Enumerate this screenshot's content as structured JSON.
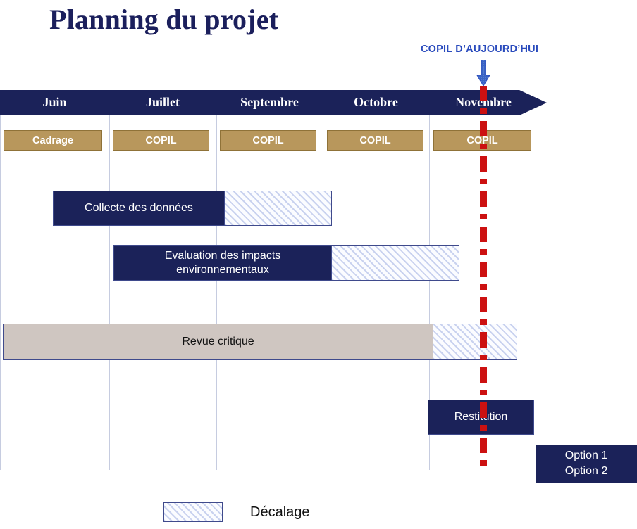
{
  "title": "Planning du projet",
  "today_marker": {
    "label": "COPIL D’AUJOURD’HUI",
    "icon": "down-arrow-icon",
    "color": "#2a4bbd",
    "line_color": "#cc1111",
    "at_month": "Novembre"
  },
  "timeline": {
    "months": [
      "Juin",
      "Juillet",
      "Septembre",
      "Octobre",
      "Novembre"
    ],
    "band_color": "#1b2259",
    "text_color": "#ffffff"
  },
  "milestones": {
    "fill_color": "#b8975c",
    "items": [
      "Cadrage",
      "COPIL",
      "COPIL",
      "COPIL",
      "COPIL"
    ]
  },
  "tasks": [
    {
      "label": "Collecte des données",
      "style": "dark",
      "has_delay": true
    },
    {
      "label": "Evaluation des impacts environnementaux",
      "style": "dark",
      "has_delay": true
    },
    {
      "label": "Revue critique",
      "style": "light",
      "has_delay": true
    },
    {
      "label": "Restitution",
      "style": "dark",
      "has_delay": false
    }
  ],
  "options_box": {
    "line1": "Option 1",
    "line2": "Option 2"
  },
  "legend": {
    "swatch_name": "hatched-delay-swatch",
    "label": "Décalage"
  },
  "chart_data": {
    "type": "gantt",
    "title": "Planning du projet",
    "categories": [
      "Juin",
      "Juillet",
      "Septembre",
      "Octobre",
      "Novembre"
    ],
    "today_line_month": "Novembre",
    "bars": [
      {
        "name": "Collecte des données",
        "start_month": "Juin",
        "end_month": "Septembre",
        "delay_end_month": "Octobre"
      },
      {
        "name": "Evaluation des impacts environnementaux",
        "start_month": "Juillet",
        "end_month": "Octobre",
        "delay_end_month": "Novembre"
      },
      {
        "name": "Revue critique",
        "start_month": "Juin",
        "end_month": "Novembre",
        "delay_end_month": "Novembre"
      },
      {
        "name": "Restitution",
        "start_month": "Novembre",
        "end_month": "Novembre",
        "delay_end_month": null
      }
    ],
    "legend": [
      "Décalage"
    ]
  }
}
